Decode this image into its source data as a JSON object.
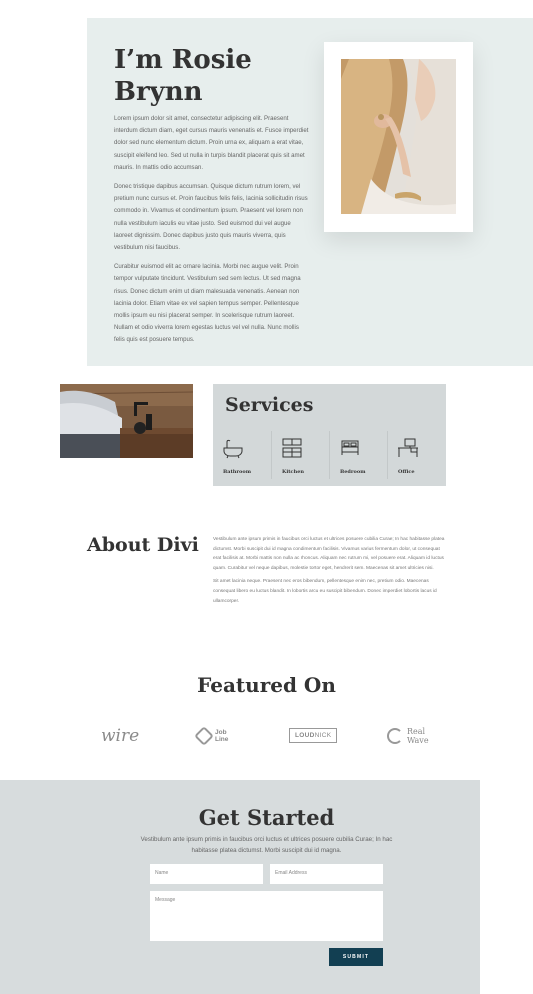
{
  "hero": {
    "title": "I’m Rosie Brynn",
    "paragraphs": [
      "Lorem ipsum dolor sit amet, consectetur adipiscing elit. Praesent interdum dictum diam, eget cursus mauris venenatis et. Fusce imperdiet dolor sed nunc elementum dictum. Proin urna ex, aliquam a erat vitae, suscipit eleifend leo. Sed ut nulla in turpis blandit placerat quis sit amet mauris. In mattis odio accumsan.",
      "Donec tristique dapibus accumsan. Quisque dictum rutrum lorem, vel pretium nunc cursus et. Proin faucibus felis felis, lacinia sollicitudin risus commodo in. Vivamus et condimentum ipsum. Praesent vel lorem non nulla vestibulum iaculis eu vitae justo. Sed euismod dui vel augue laoreet dignissim. Donec dapibus justo quis mauris viverra, quis vestibulum nisi faucibus.",
      "Curabitur euismod elit ac ornare lacinia. Morbi nec augue velit. Proin tempor vulputate tincidunt. Vestibulum sed sem lectus. Ut sed magna risus. Donec dictum enim ut diam malesuada venenatis. Aenean non lacinia dolor. Etiam vitae ex vel sapien tempus semper. Pellentesque mollis ipsum eu nisi placerat semper. In scelerisque rutrum laoreet. Nullam et odio viverra lorem egestas luctus vel vel nulla. Nunc mollis felis quis est posuere tempus."
    ]
  },
  "services": {
    "title": "Services",
    "items": [
      {
        "label": "Bathroom",
        "icon": "bathtub-icon"
      },
      {
        "label": "Kitchen",
        "icon": "kitchen-icon"
      },
      {
        "label": "Bedroom",
        "icon": "bed-icon"
      },
      {
        "label": "Office",
        "icon": "desk-icon"
      }
    ]
  },
  "about": {
    "title": "About Divi",
    "paragraphs": [
      "Vestibulum ante ipsum primis in faucibus orci luctus et ultrices posuere cubilia Curae; In hac habitasse platea dictumst. Morbi suscipit dui id magna condimentum facilisis. Vivamus varius fermentum dolor, ut consequat erat facilisis at. Morbi mattis non nulla ac rhoncus. Aliquam nec rutrum mi, vel posuere erat. Aliquam id luctus quam. Curabitur vel neque dapibus, molestie tortor eget, hendrerit sem. Maecenas sit amet ultricies nisi.",
      "Sit amet lacinia neque. Praesent nec eros bibendum, pellentesque enim nec, pretium odio. Maecenas consequat libero eu luctus blandit. In lobortis arcu eu suscipit bibendum. Donec imperdiet lobortis lacus id ullamcorper."
    ]
  },
  "featured": {
    "title": "Featured On",
    "logos": {
      "wire": "wire",
      "job_line_1": "Job",
      "job_line_2": "Line",
      "loud_a": "LOUD",
      "loud_b": "NICK",
      "wave_line_1": "Real",
      "wave_line_2": "Wave"
    }
  },
  "get_started": {
    "title": "Get Started",
    "text": "Vestibulum ante ipsum primis in faucibus orci luctus et ultrices posuere cubilia Curae; In hac habitasse platea dictumst. Morbi suscipit dui id magna.",
    "name_placeholder": "Name",
    "email_placeholder": "Email Address",
    "message_placeholder": "Message",
    "submit_label": "SUBMIT"
  },
  "colors": {
    "hero_bg": "#e7eeed",
    "services_bg": "#d3d8d9",
    "get_started_bg": "#d7dcdd",
    "button": "#123f52"
  }
}
